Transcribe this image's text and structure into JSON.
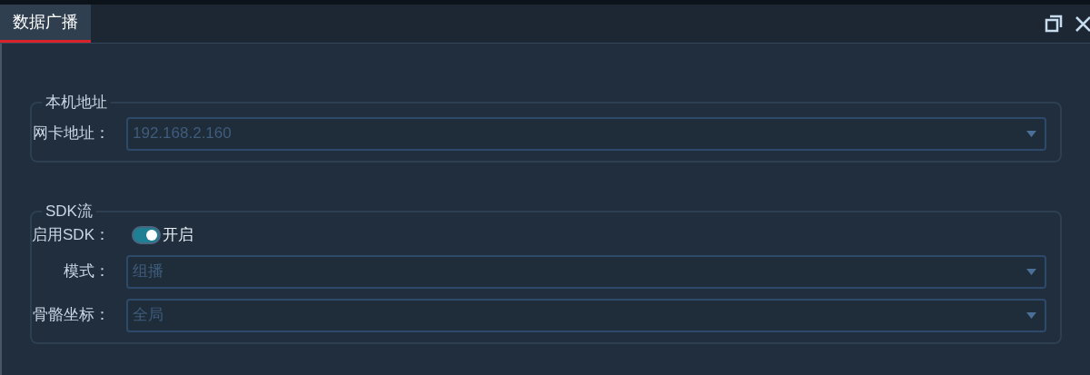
{
  "tab": {
    "label": "数据广播",
    "selected": true
  },
  "groups": [
    {
      "title": "本机地址",
      "rows": [
        {
          "kind": "select",
          "label": "网卡地址：",
          "value": "192.168.2.160"
        }
      ]
    },
    {
      "title": "SDK流",
      "rows": [
        {
          "kind": "switch",
          "label": "启用SDK：",
          "on": true,
          "text": "开启"
        },
        {
          "kind": "select",
          "label": "模式：",
          "value": "组播"
        },
        {
          "kind": "select",
          "label": "骨骼坐标：",
          "value": "全局"
        }
      ]
    }
  ]
}
